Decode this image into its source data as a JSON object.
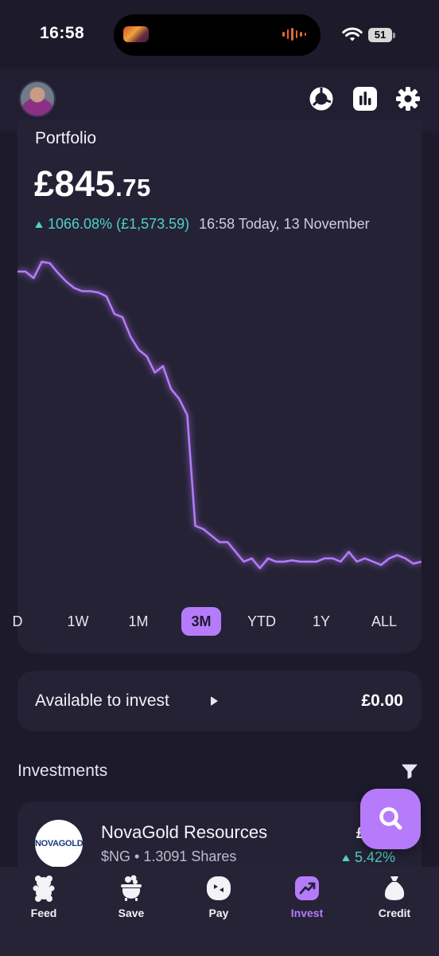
{
  "status_bar": {
    "time": "16:58",
    "battery": "51"
  },
  "header": {
    "avatar": "profile-avatar",
    "icons": [
      "donut-chart-icon",
      "bar-chart-icon",
      "gear-icon"
    ]
  },
  "portfolio": {
    "title": "Portfolio",
    "balance_main": "£845",
    "balance_pence": ".75",
    "change": "1066.08% (£1,573.59)",
    "timestamp": "16:58 Today, 13 November",
    "accent_color": "#b57bfa",
    "up_color": "#4fd1c5"
  },
  "chart_data": {
    "type": "line",
    "series": [
      {
        "values": [
          200,
          200,
          190,
          215,
          213,
          198,
          185,
          175,
          170,
          170,
          168,
          162,
          135,
          130,
          100,
          80,
          70,
          45,
          55,
          20,
          5,
          -20,
          -190,
          -195,
          -205,
          -215,
          -215,
          -230,
          -245,
          -240,
          -255,
          -240,
          -245,
          -245,
          -243,
          -245,
          -245,
          -245,
          -240,
          -240,
          -245,
          -230,
          -245,
          -240,
          -245,
          -250,
          -240,
          -235,
          -240,
          -248,
          -245
        ]
      }
    ],
    "ylim": [
      -300,
      250
    ],
    "color": "#b57bfa"
  },
  "ranges": {
    "items": [
      "D",
      "1W",
      "1M",
      "3M",
      "YTD",
      "1Y",
      "ALL"
    ],
    "selected": "3M"
  },
  "available": {
    "label": "Available to invest",
    "value": "£0.00"
  },
  "investments": {
    "title": "Investments",
    "items": [
      {
        "logo": "NOVAGOLD",
        "name": "NovaGold Resources",
        "ticker_shares": "$NG • 1.3091 Shares",
        "price": "£",
        "change": "5.42%"
      }
    ]
  },
  "tabs": [
    {
      "label": "Feed",
      "icon": "gummy-bear-icon"
    },
    {
      "label": "Save",
      "icon": "pot-icon"
    },
    {
      "label": "Pay",
      "icon": "pay-icon"
    },
    {
      "label": "Invest",
      "icon": "invest-icon",
      "active": true
    },
    {
      "label": "Credit",
      "icon": "money-bag-icon"
    }
  ]
}
